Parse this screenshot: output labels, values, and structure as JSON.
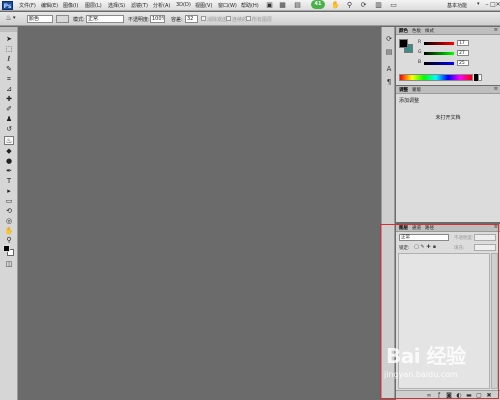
{
  "app": {
    "logo": "Ps"
  },
  "menubar": {
    "items": [
      "文件(F)",
      "编辑(E)",
      "图像(I)",
      "图层(L)",
      "选择(S)",
      "滤镜(T)",
      "分析(A)",
      "3D(D)",
      "视图(V)",
      "窗口(W)",
      "帮助(H)"
    ],
    "badge": "41",
    "workspace": "基本功能",
    "workspace_arrow": "▾",
    "window_buttons": [
      "–",
      "□",
      "✕"
    ]
  },
  "optionsbar": {
    "mode_value": "颜色",
    "mode_label": "模式:",
    "mode_selected": "正常",
    "opacity_label": "不透明度:",
    "opacity_value": "100%",
    "tolerance_label": "容差:",
    "tolerance_value": "32",
    "antialias_label": "消除锯齿",
    "contiguous_label": "连续的",
    "all_layers_label": "所有图层"
  },
  "panels": {
    "color": {
      "tabs": [
        "颜色",
        "色板",
        "样式"
      ],
      "channels": [
        {
          "label": "R",
          "value": "17",
          "color_from": "#000000",
          "color_to": "#ff0000"
        },
        {
          "label": "G",
          "value": "27",
          "color_from": "#000000",
          "color_to": "#00ff00"
        },
        {
          "label": "B",
          "value": "25",
          "color_from": "#000000",
          "color_to": "#0000ff"
        }
      ]
    },
    "adjustments": {
      "tabs": [
        "调整",
        "蒙版"
      ],
      "title": "添加调整",
      "no_document": "未打开文档"
    },
    "layers": {
      "tabs": [
        "图层",
        "通道",
        "路径"
      ],
      "blend_mode": "正常",
      "opacity_label": "不透明度:",
      "lock_label": "锁定:",
      "fill_label": "填充:"
    }
  },
  "watermark": {
    "brand": "Bai 经验",
    "url": "jingyan.baidu.com"
  },
  "colors": {
    "canvas_bg": "#6b6b6b",
    "highlight": "#d3303a",
    "badge": "#49b146"
  }
}
